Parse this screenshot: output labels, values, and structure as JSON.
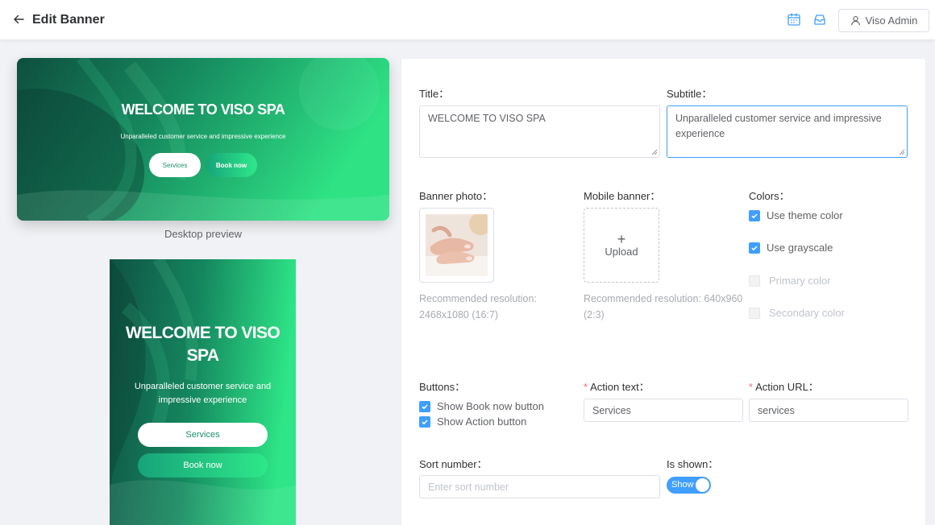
{
  "header": {
    "title": "Edit Banner",
    "user_label": "Viso Admin"
  },
  "icons": [
    "arrow-left-icon",
    "calendar-icon",
    "inbox-icon",
    "user-icon",
    "plus-icon",
    "check-icon"
  ],
  "colors": {
    "accent": "#409eff",
    "brand_green_dark": "#0f5a46",
    "brand_green_light": "#2ee88a",
    "required": "#f56c6c"
  },
  "preview": {
    "banner_title": "WELCOME TO VISO SPA",
    "banner_subtitle": "Unparalleled customer service and impressive experience",
    "services_button": "Services",
    "book_now_button": "Book now",
    "desktop_caption": "Desktop preview"
  },
  "form": {
    "title_label": "Title：",
    "title_value": "WELCOME TO VISO SPA",
    "subtitle_label": "Subtitle：",
    "subtitle_value": "Unparalleled customer service and impressive experience",
    "banner_photo_label": "Banner photo：",
    "banner_photo_hint": "Recommended resolution: 2468x1080 (16:7)",
    "mobile_banner_label": "Mobile banner：",
    "upload_label": "Upload",
    "mobile_banner_hint": "Recommended resolution: 640x960 (2:3)",
    "colors_label": "Colors：",
    "colors_options": [
      {
        "label": "Use theme color",
        "checked": true,
        "disabled": false
      },
      {
        "label": "Use grayscale",
        "checked": true,
        "disabled": false
      },
      {
        "label": "Primary color",
        "checked": false,
        "disabled": true
      },
      {
        "label": "Secondary color",
        "checked": false,
        "disabled": true
      }
    ],
    "buttons_label": "Buttons：",
    "buttons_options": [
      {
        "label": "Show Book now button",
        "checked": true
      },
      {
        "label": "Show Action button",
        "checked": true
      }
    ],
    "action_text_label": "Action text：",
    "action_text_value": "Services",
    "action_url_label": "Action URL：",
    "action_url_value": "services",
    "required_mark": "*",
    "sort_number_label": "Sort number：",
    "sort_number_placeholder": "Enter sort number",
    "is_shown_label": "Is shown：",
    "is_shown_toggle": "Show",
    "is_shown": true
  }
}
